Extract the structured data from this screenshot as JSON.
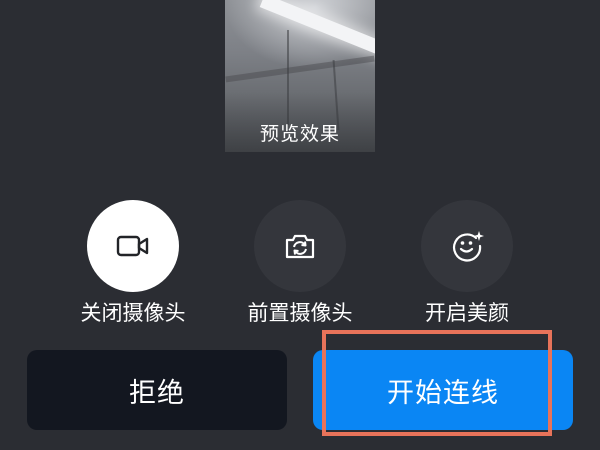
{
  "preview": {
    "label": "预览效果"
  },
  "controls": [
    {
      "label": "关闭摄像头",
      "icon": "video-camera-icon",
      "active": true
    },
    {
      "label": "前置摄像头",
      "icon": "camera-switch-icon",
      "active": false
    },
    {
      "label": "开启美颜",
      "icon": "smiley-sparkle-icon",
      "active": false
    }
  ],
  "actions": {
    "reject_label": "拒绝",
    "start_label": "开始连线"
  },
  "colors": {
    "background": "#2b2d33",
    "reject_button": "#131720",
    "start_button": "#0a86f4",
    "highlight_border": "#e8735a"
  }
}
